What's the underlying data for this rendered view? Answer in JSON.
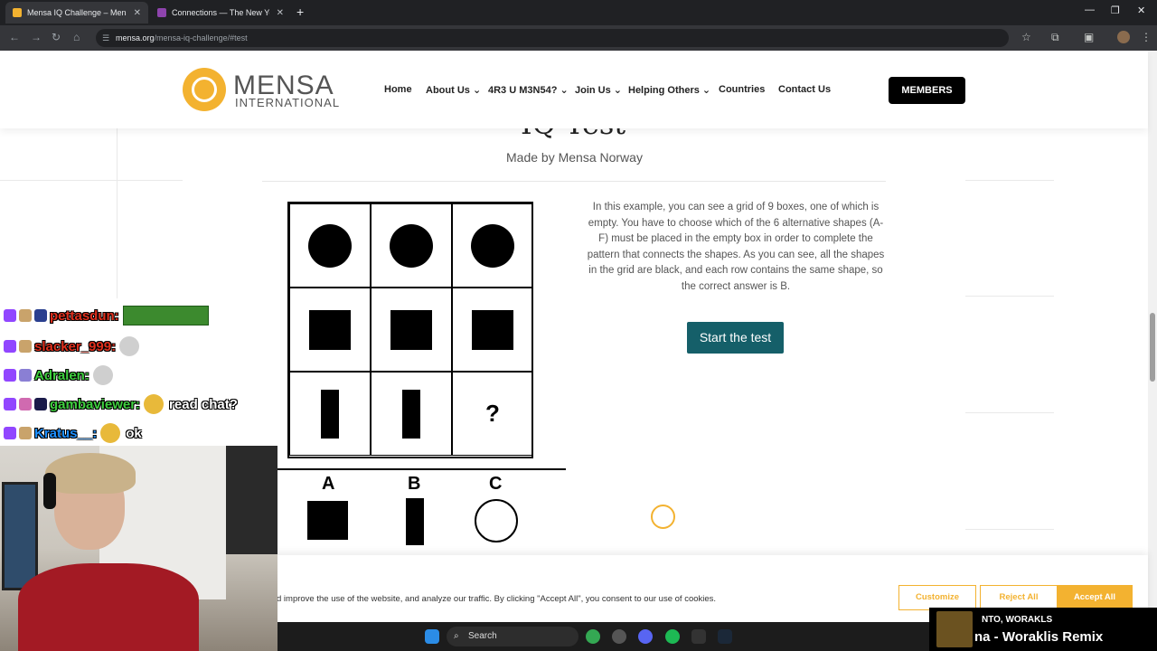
{
  "browser": {
    "tabs": [
      {
        "title": "Mensa IQ Challenge – Mensa Int",
        "active": true
      },
      {
        "title": "Connections — The New York Tim",
        "active": false
      }
    ],
    "new_tab": "+",
    "close": "✕",
    "url_domain": "mensa.org",
    "url_path": "/mensa-iq-challenge/#test"
  },
  "site": {
    "logo_name": "MENSA",
    "logo_sub": "INTERNATIONAL",
    "nav": [
      "Home",
      "About Us",
      "4R3 U M3N54?",
      "Join Us",
      "Helping Others",
      "Countries",
      "Contact Us"
    ],
    "members": "MEMBERS"
  },
  "test": {
    "title_partial": "IQ Test",
    "subtitle": "Made by Mensa Norway",
    "question_mark": "?",
    "options": [
      "A",
      "B",
      "C"
    ],
    "description": "In this example, you can see a grid of 9 boxes, one of which is empty. You have to choose which of the 6 alternative shapes (A-F) must be placed in the empty box in order to complete the pattern that connects the shapes. As you can see, all the shapes in the grid are black, and each row contains the same shape, so the correct answer is B.",
    "start_button": "Start the test"
  },
  "cookie": {
    "text": "d improve the use of the website, and analyze our traffic. By clicking \"Accept All\", you consent to our use of cookies.",
    "customize": "Customize",
    "reject": "Reject All",
    "accept": "Accept All"
  },
  "taskbar": {
    "search": "Search"
  },
  "chat": [
    {
      "user": "pettasdun:",
      "color": "#e0301e",
      "msg": ""
    },
    {
      "user": "slacker_999:",
      "color": "#e0301e",
      "msg": ""
    },
    {
      "user": "Adralen:",
      "color": "#3fcf3f",
      "msg": ""
    },
    {
      "user": "gambaviewer:",
      "color": "#3fcf3f",
      "msg": "read chat?"
    },
    {
      "user": "Kratus__:",
      "color": "#1e90ff",
      "msg": "ok"
    }
  ],
  "now_playing": {
    "artist": "NTO, WORAKLS",
    "title": "na - Woraklis Remix"
  }
}
